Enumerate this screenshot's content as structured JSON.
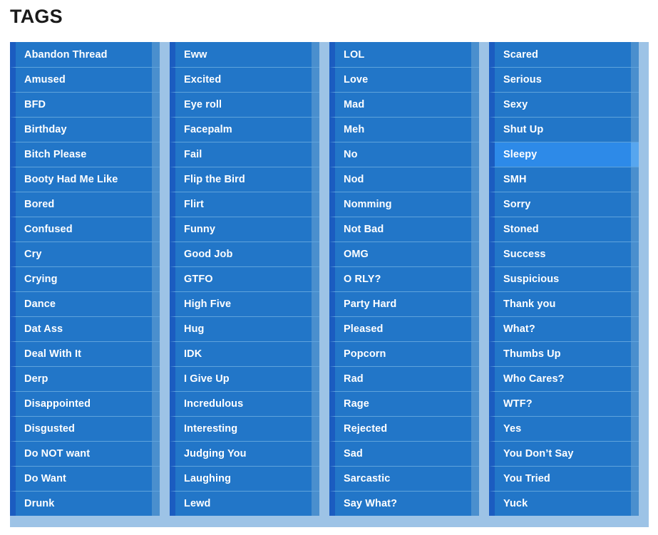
{
  "page": {
    "title": "TAGS"
  },
  "theme": {
    "page_background": "#ffffff",
    "container_background": "#9dc3e6",
    "item_background": "#2276c8",
    "item_left_border": "#1b5cc0",
    "item_right_strip": "#4a8fce",
    "item_separator": "#5fa3dc",
    "item_selected_background": "#2d8ae8",
    "item_text": "#ffffff",
    "title_text": "#1a1a1a"
  },
  "tags": {
    "selected": "Sleepy",
    "columns": [
      {
        "name": "column-1",
        "items": [
          "Abandon Thread",
          "Amused",
          "BFD",
          "Birthday",
          "Bitch Please",
          "Booty Had Me Like",
          "Bored",
          "Confused",
          "Cry",
          "Crying",
          "Dance",
          "Dat Ass",
          "Deal With It",
          "Derp",
          "Disappointed",
          "Disgusted",
          "Do NOT want",
          "Do Want",
          "Drunk"
        ]
      },
      {
        "name": "column-2",
        "items": [
          "Eww",
          "Excited",
          "Eye roll",
          "Facepalm",
          "Fail",
          "Flip the Bird",
          "Flirt",
          "Funny",
          "Good Job",
          "GTFO",
          "High Five",
          "Hug",
          "IDK",
          "I Give Up",
          "Incredulous",
          "Interesting",
          "Judging You",
          "Laughing",
          "Lewd"
        ]
      },
      {
        "name": "column-3",
        "items": [
          "LOL",
          "Love",
          "Mad",
          "Meh",
          "No",
          "Nod",
          "Nomming",
          "Not Bad",
          "OMG",
          "O RLY?",
          "Party Hard",
          "Pleased",
          "Popcorn",
          "Rad",
          "Rage",
          "Rejected",
          "Sad",
          "Sarcastic",
          "Say What?"
        ]
      },
      {
        "name": "column-4",
        "items": [
          "Scared",
          "Serious",
          "Sexy",
          "Shut Up",
          "Sleepy",
          "SMH",
          "Sorry",
          "Stoned",
          "Success",
          "Suspicious",
          "Thank you",
          "What?",
          "Thumbs Up",
          "Who Cares?",
          "WTF?",
          "Yes",
          "You Don’t Say",
          "You Tried",
          "Yuck"
        ]
      }
    ]
  }
}
